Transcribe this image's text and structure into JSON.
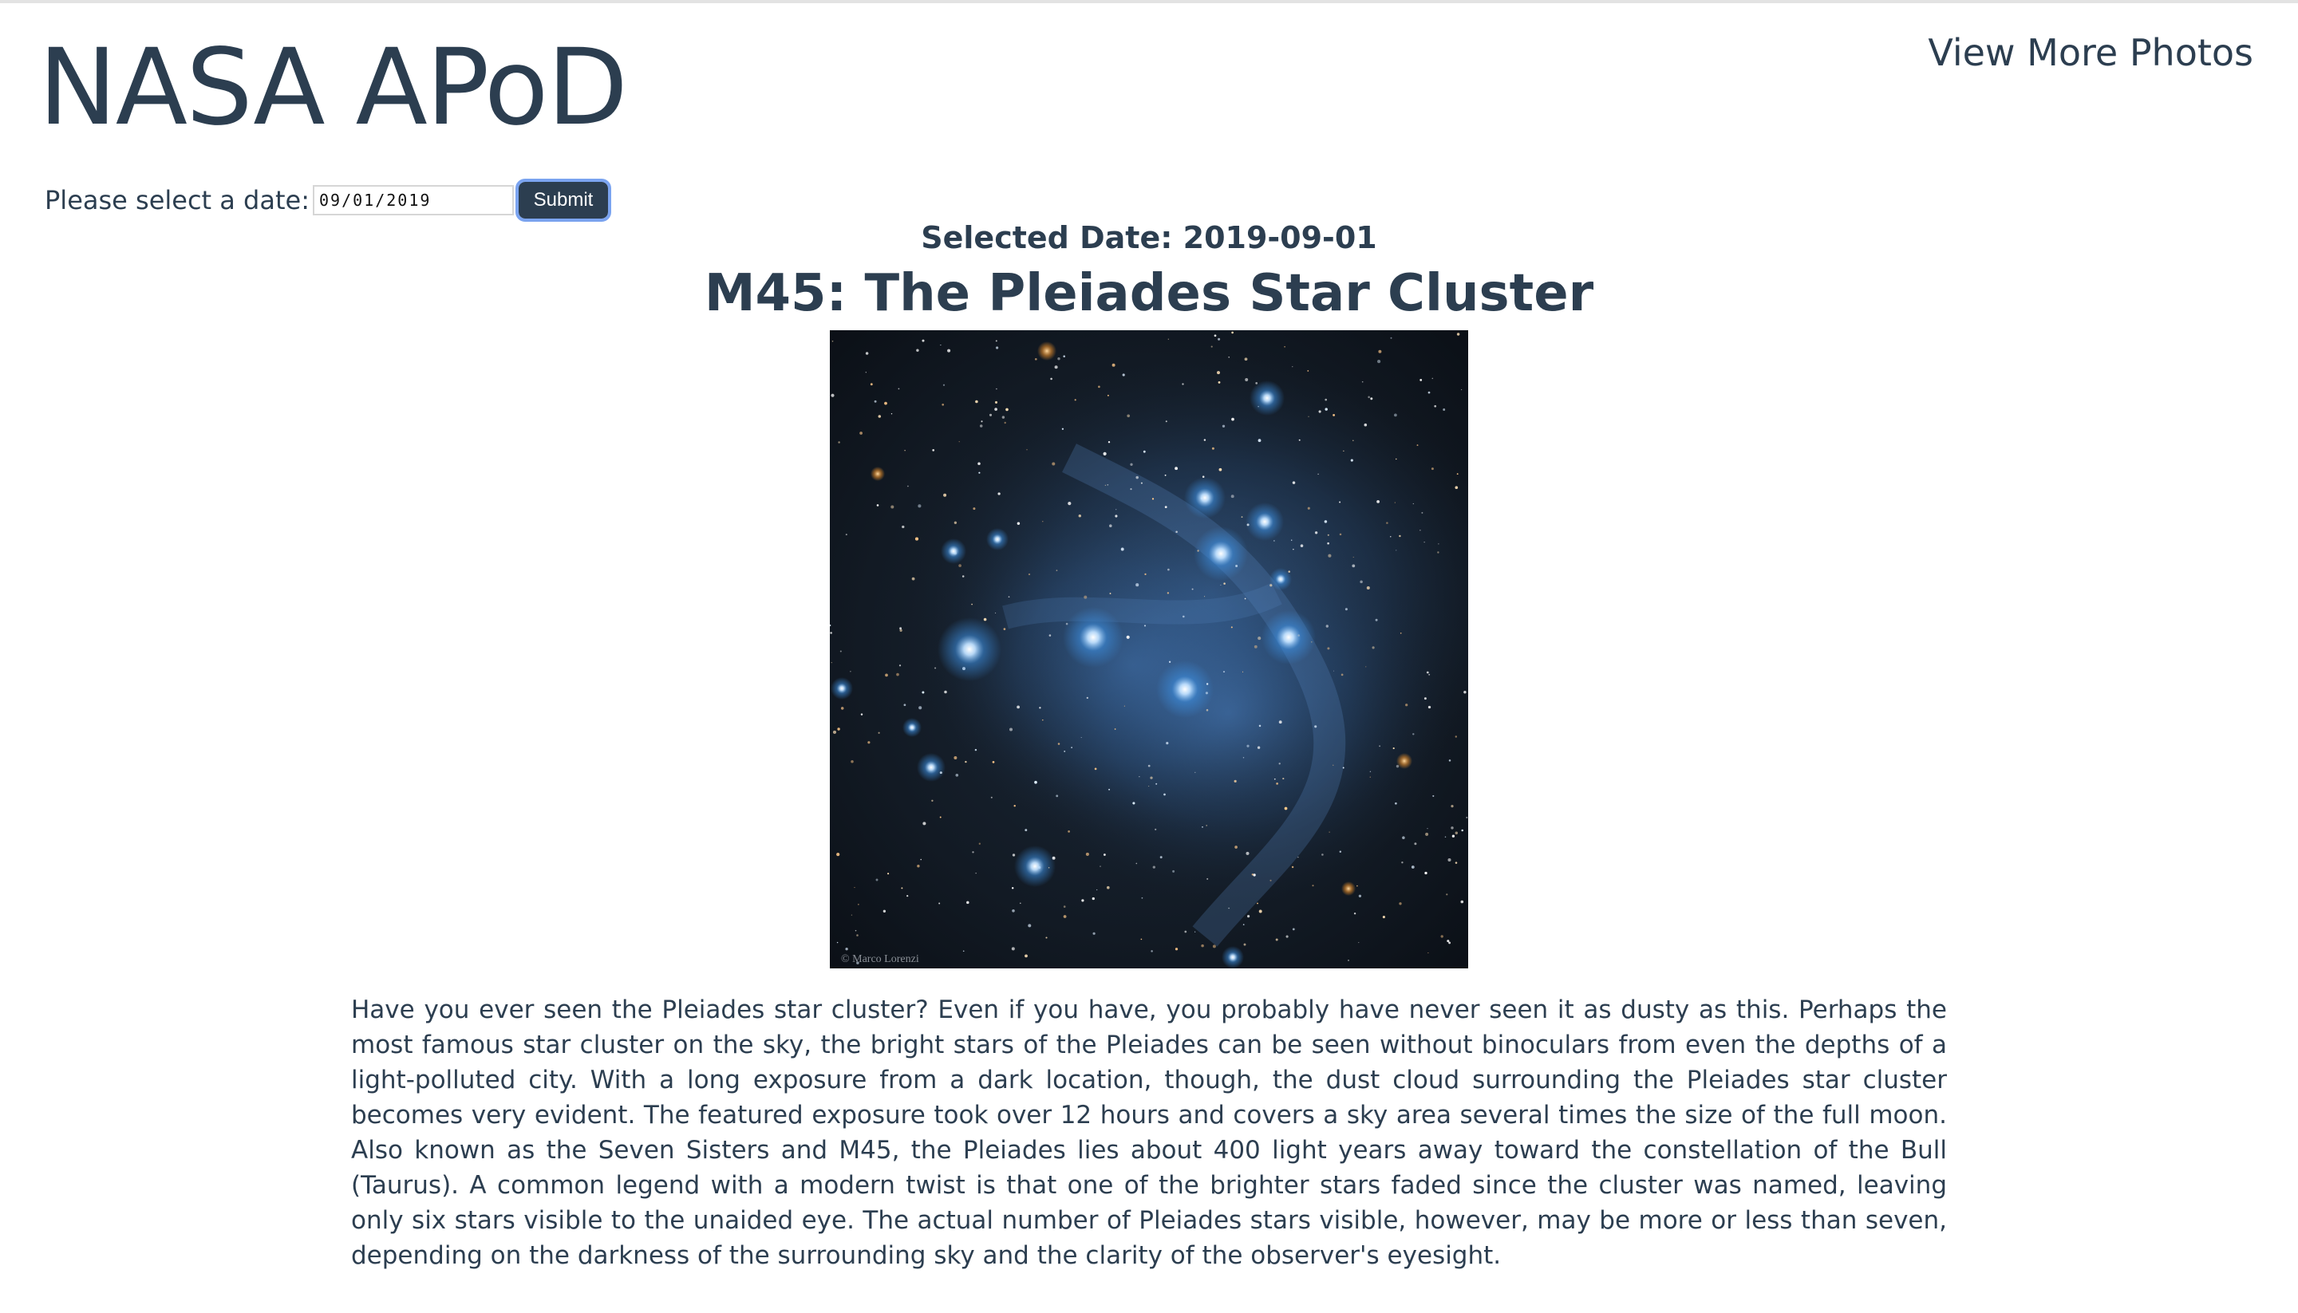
{
  "site": {
    "title": "NASA APoD",
    "more_link": "View More Photos"
  },
  "date_form": {
    "label": "Please select a date:",
    "value": "09/01/2019",
    "submit_label": "Submit"
  },
  "apod": {
    "selected_date": "Selected Date: 2019-09-01",
    "title": "M45: The Pleiades Star Cluster",
    "image_credit": "© Marco Lorenzi",
    "explanation": "Have you ever seen the Pleiades star cluster? Even if you have, you probably have never seen it as dusty as this. Perhaps the most famous star cluster on the sky, the bright stars of the Pleiades can be seen without binoculars from even the depths of a light-polluted city. With a long exposure from a dark location, though, the dust cloud surrounding the Pleiades star cluster becomes very evident. The featured exposure took over 12 hours and covers a sky area several times the size of the full moon. Also known as the Seven Sisters and M45, the Pleiades lies about 400 light years away toward the constellation of the Bull (Taurus). A common legend with a modern twist is that one of the brighter stars faded since the cluster was named, leaving only six stars visible to the unaided eye. The actual number of Pleiades stars visible, however, may be more or less than seven, depending on the darkness of the surrounding sky and the clarity of the observer's eyesight."
  },
  "colors": {
    "text": "#2c3e50",
    "button_bg": "#2c3e50",
    "focus_ring": "#7ba4f0",
    "nebula_blue": "#3d8fe0"
  }
}
